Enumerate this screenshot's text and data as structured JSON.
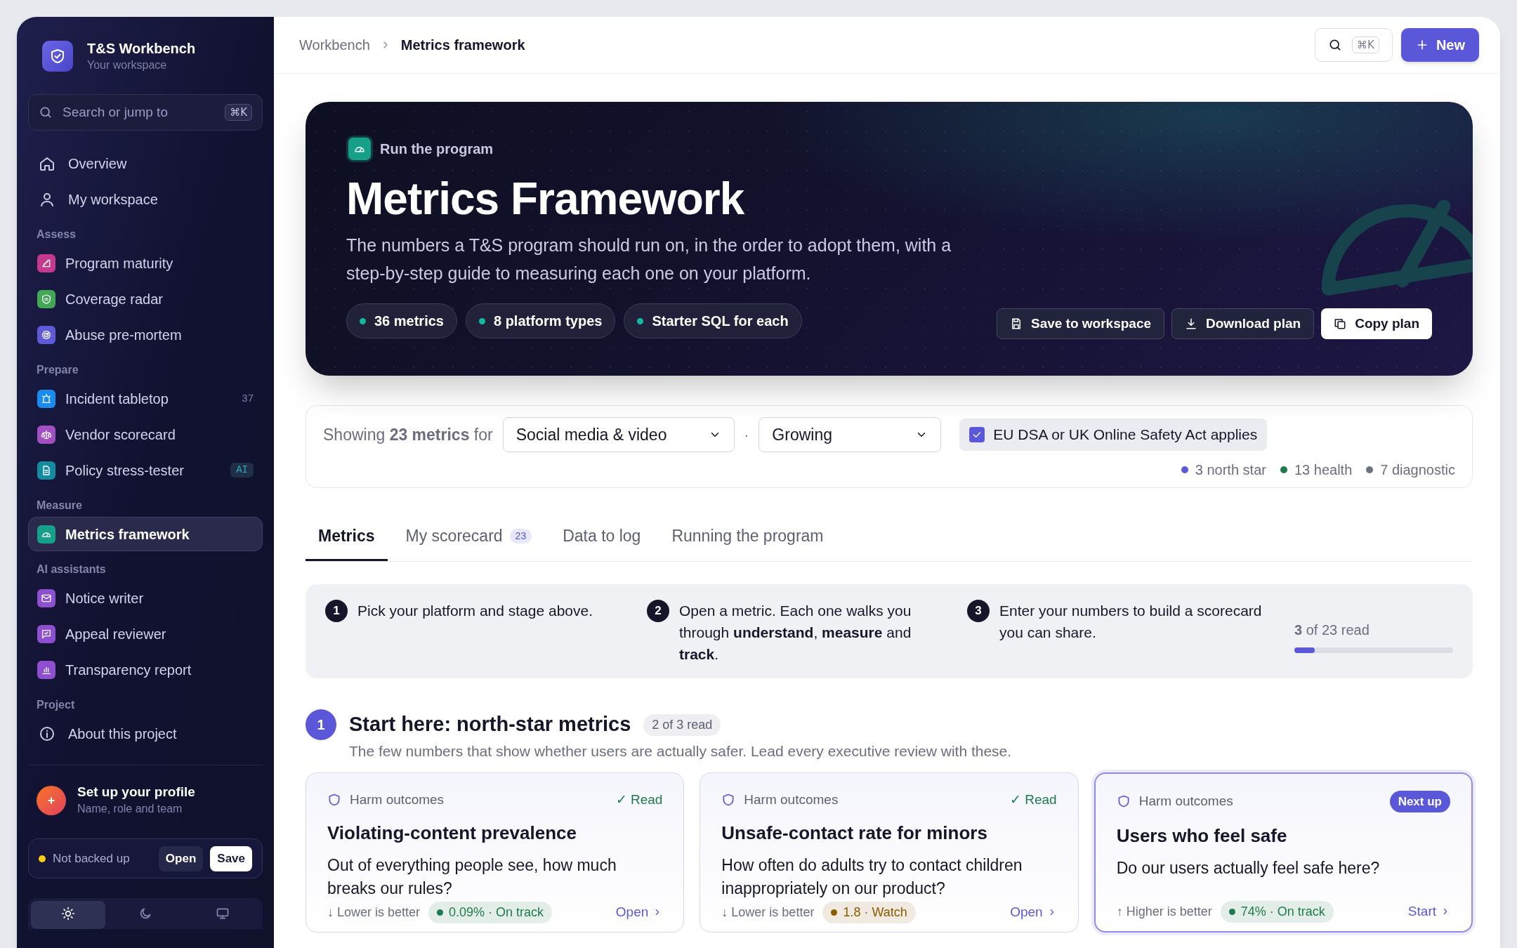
{
  "sidebar": {
    "brand": {
      "title": "T&S Workbench",
      "subtitle": "Your workspace"
    },
    "search": {
      "placeholder": "Search or jump to",
      "shortcut": "⌘K"
    },
    "top_items": [
      {
        "label": "Overview",
        "selected": false
      },
      {
        "label": "My workspace",
        "selected": false
      }
    ],
    "sections": [
      {
        "title": "Assess",
        "items": [
          {
            "label": "Program maturity",
            "color": "#c43a8f",
            "selected": false
          },
          {
            "label": "Coverage radar",
            "color": "#43a856",
            "selected": false
          },
          {
            "label": "Abuse pre-mortem",
            "color": "#5f5bd8",
            "selected": false
          }
        ]
      },
      {
        "title": "Prepare",
        "items": [
          {
            "label": "Incident tabletop",
            "color": "#1a8cf0",
            "selected": false,
            "count": "37"
          },
          {
            "label": "Vendor scorecard",
            "color": "#a34fc4",
            "selected": false
          },
          {
            "label": "Policy stress-tester",
            "color": "#138ba0",
            "selected": false,
            "tag": "AI"
          }
        ]
      },
      {
        "title": "Measure",
        "items": [
          {
            "label": "Metrics framework",
            "color": "#16a08a",
            "selected": true
          }
        ]
      },
      {
        "title": "AI assistants",
        "items": [
          {
            "label": "Notice writer",
            "color": "#8e4fd0",
            "selected": false
          },
          {
            "label": "Appeal reviewer",
            "color": "#8e4fd0",
            "selected": false
          },
          {
            "label": "Transparency report",
            "color": "#8e4fd0",
            "selected": false
          }
        ]
      },
      {
        "title": "Project",
        "items": [
          {
            "label": "About this project",
            "selected": false
          }
        ]
      }
    ],
    "profile": {
      "initial": "+",
      "title": "Set up your profile",
      "subtitle": "Name, role and team"
    },
    "backup": {
      "status": "Not backed up",
      "backed_up": false,
      "buttons": [
        "Open",
        "Save"
      ]
    },
    "theme_options": [
      {
        "selected": true
      },
      {
        "selected": false
      },
      {
        "selected": false
      }
    ]
  },
  "header": {
    "breadcrumb": [
      "Workbench",
      "Metrics framework"
    ],
    "shortcut": "⌘K",
    "new_button": "New"
  },
  "hero": {
    "eyebrow": "Run the program",
    "title": "Metrics Framework",
    "description": "The numbers a T&S program should run on, in the order to adopt them, with a step-by-step guide to measuring each one on your platform.",
    "chips": [
      "36 metrics",
      "8 platform types",
      "Starter SQL for each"
    ],
    "actions": [
      {
        "label": "Save to workspace",
        "primary": false
      },
      {
        "label": "Download plan",
        "primary": false
      },
      {
        "label": "Copy plan",
        "primary": true
      }
    ]
  },
  "filters": {
    "summary": "Showing **23 metrics** for",
    "platform": "Social media & video",
    "separator": "·",
    "stage": "Growing",
    "checkbox": {
      "label": "EU DSA or UK Online Safety Act applies",
      "checked": true
    },
    "legend": [
      {
        "label": "3 north star",
        "color": "#5b5bd6"
      },
      {
        "label": "13 health",
        "color": "#1f7a4d"
      },
      {
        "label": "7 diagnostic",
        "color": "#6b7280"
      }
    ]
  },
  "tabs": [
    {
      "label": "Metrics",
      "selected": true
    },
    {
      "label": "My scorecard",
      "count": "23",
      "selected": false
    },
    {
      "label": "Data to log",
      "selected": false
    },
    {
      "label": "Running the program",
      "selected": false
    }
  ],
  "steps": [
    {
      "number": "1",
      "text": "Pick your platform and stage above."
    },
    {
      "number": "2",
      "text": "Open a metric. Each one walks you through **understand**, **measure** and **track**."
    },
    {
      "number": "3",
      "text": "Enter your numbers to build a scorecard you can share."
    }
  ],
  "progress": {
    "text": "**3** of 23 read",
    "level": 0.13
  },
  "section": {
    "number": "1",
    "title": "Start here: north-star metrics",
    "badge": "2 of 3 read",
    "subtitle": "The few numbers that show whether users are actually safer. Lead every executive review with these."
  },
  "cards": [
    {
      "kind": "read",
      "category": "Harm outcomes",
      "status": "✓ Read",
      "title": "Violating-content prevalence",
      "question": "Out of everything people see, how much breaks our rules?",
      "direction": "↓ Lower is better",
      "value": "0.09% · On track",
      "color": "#1f7a4d",
      "link": "Open"
    },
    {
      "kind": "read",
      "category": "Harm outcomes",
      "status": "✓ Read",
      "title": "Unsafe-contact rate for minors",
      "question": "How often do adults try to contact children inappropriately on our product?",
      "direction": "↓ Lower is better",
      "value": "1.8 · Watch",
      "color": "#8a5a00",
      "link": "Open"
    },
    {
      "kind": "next",
      "category": "Harm outcomes",
      "status": "Next up",
      "title": "Users who feel safe",
      "question": "Do our users actually feel safe here?",
      "direction": "↑ Higher is better",
      "value": "74% · On track",
      "color": "#1f7a4d",
      "link": "Start"
    }
  ]
}
